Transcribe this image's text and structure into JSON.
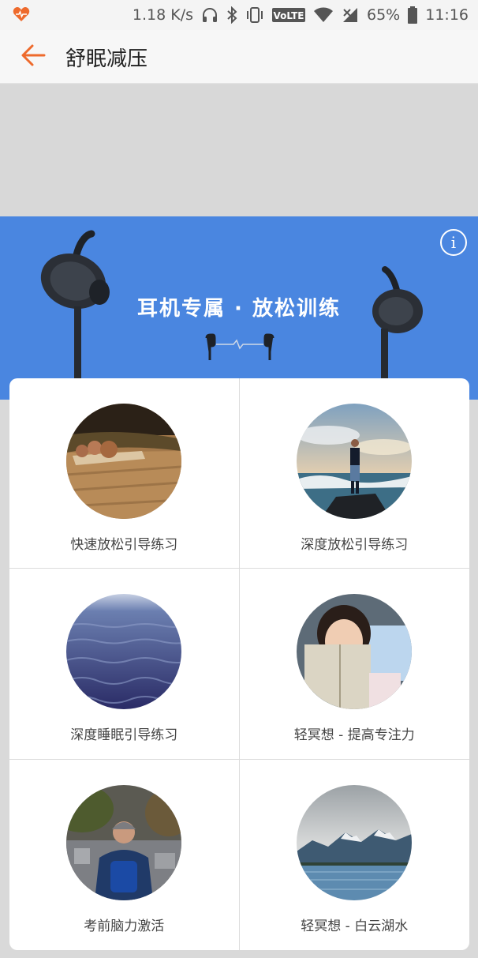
{
  "status_bar": {
    "network_speed": "1.18 K/s",
    "volte_label": "VoLTE",
    "battery_percent": "65%",
    "time": "11:16",
    "icons": [
      "health-heart-icon",
      "headphones-icon",
      "bluetooth-icon",
      "vibrate-icon",
      "volte-icon",
      "wifi-icon",
      "cell-signal-icon",
      "battery-icon"
    ]
  },
  "app_bar": {
    "back_icon": "arrow-left-icon",
    "title": "舒眠减压",
    "accent_color": "#ee6a2c"
  },
  "banner": {
    "title": "耳机专属 · 放松训练",
    "info_label": "i",
    "background_color": "#4a86e0"
  },
  "cards": [
    {
      "label": "快速放松引导练习",
      "image": "stones-on-wood"
    },
    {
      "label": "深度放松引导练习",
      "image": "man-on-rock-by-sea"
    },
    {
      "label": "深度睡眠引导练习",
      "image": "ocean-waves"
    },
    {
      "label": "轻冥想 - 提高专注力",
      "image": "girl-reading-book"
    },
    {
      "label": "考前脑力激活",
      "image": "student-with-backpack"
    },
    {
      "label": "轻冥想 - 白云湖水",
      "image": "mountain-lake"
    }
  ]
}
